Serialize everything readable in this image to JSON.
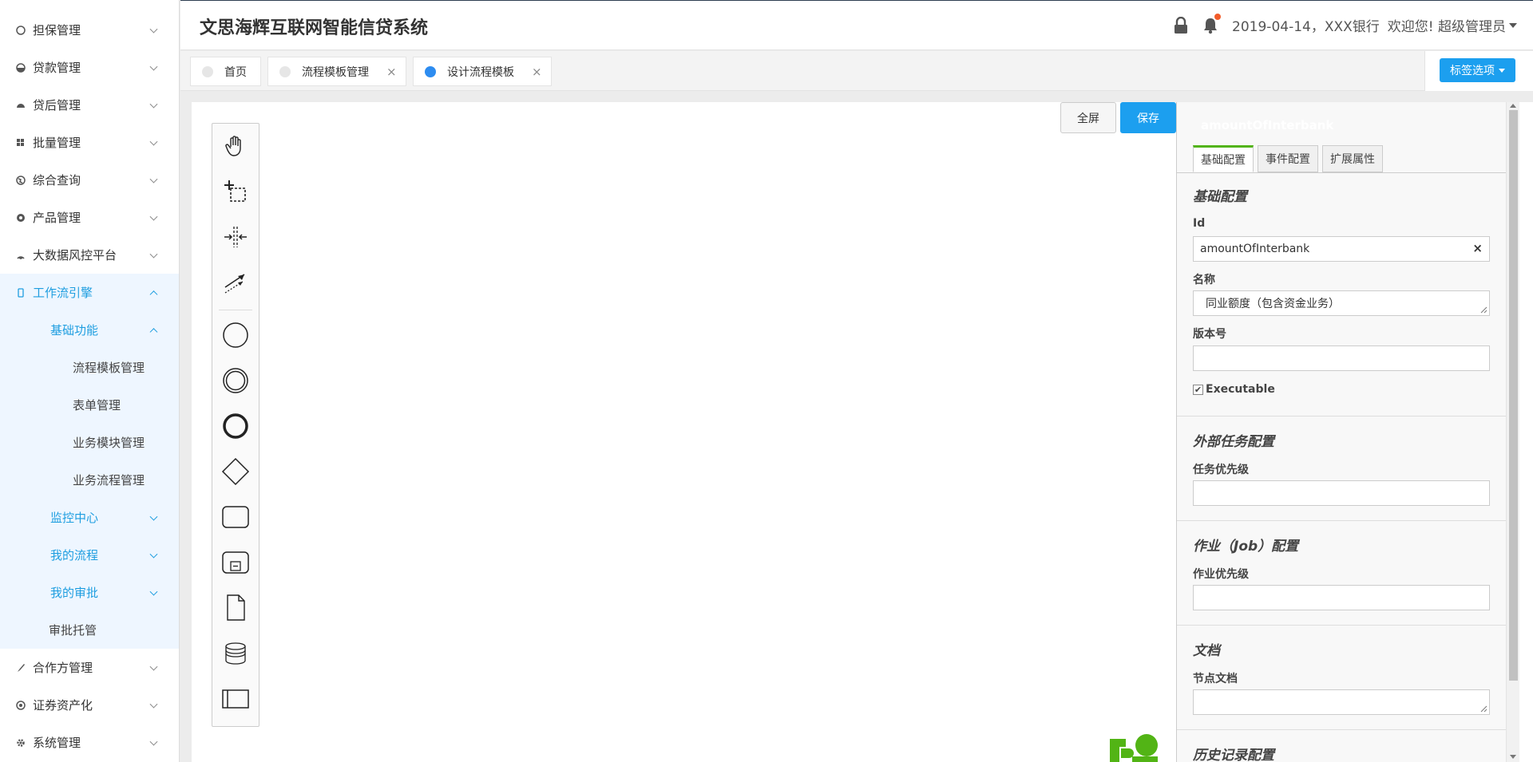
{
  "header": {
    "title": "文思海辉互联网智能信贷系统",
    "date_bank": "2019-04-14，XXX银行",
    "welcome": "欢迎您! 超级管理员"
  },
  "sidebar": {
    "items": [
      {
        "label": "担保管理",
        "icon": "circle-outline-icon"
      },
      {
        "label": "贷款管理",
        "icon": "pie-icon"
      },
      {
        "label": "贷后管理",
        "icon": "dome-icon"
      },
      {
        "label": "批量管理",
        "icon": "grid-icon"
      },
      {
        "label": "综合查询",
        "icon": "globe-icon"
      },
      {
        "label": "产品管理",
        "icon": "coin-icon"
      },
      {
        "label": "大数据风控平台",
        "icon": "signal-icon"
      },
      {
        "label": "工作流引擎",
        "icon": "mobile-icon"
      },
      {
        "label": "基础功能"
      },
      {
        "label": "流程模板管理"
      },
      {
        "label": "表单管理"
      },
      {
        "label": "业务模块管理"
      },
      {
        "label": "业务流程管理"
      },
      {
        "label": "监控中心"
      },
      {
        "label": "我的流程"
      },
      {
        "label": "我的审批"
      },
      {
        "label": "审批托管"
      },
      {
        "label": "合作方管理",
        "icon": "brush-icon"
      },
      {
        "label": "证券资产化",
        "icon": "target-icon"
      },
      {
        "label": "系统管理",
        "icon": "gear-icon"
      }
    ]
  },
  "tabs": [
    {
      "label": "首页"
    },
    {
      "label": "流程模板管理",
      "close": "×"
    },
    {
      "label": "设计流程模板",
      "close": "×"
    }
  ],
  "tag_options": "标签选项",
  "toolbar": {
    "fullscreen": "全屏",
    "save": "保存"
  },
  "palette": [
    "hand-tool-icon",
    "lasso-tool-icon",
    "space-tool-icon",
    "connect-tool-icon",
    "start-event-icon",
    "intermediate-event-icon",
    "end-event-icon",
    "gateway-icon",
    "task-icon",
    "subprocess-icon",
    "data-object-icon",
    "data-store-icon",
    "pool-icon"
  ],
  "props": {
    "element_name": "amountOfInterbank",
    "tabs": [
      "基础配置",
      "事件配置",
      "扩展属性"
    ],
    "basic_title": "基础配置",
    "id_label": "Id",
    "id_value": "amountOfInterbank",
    "clear": "×",
    "name_label": "名称",
    "name_value": "同业额度（包含资金业务）",
    "version_label": "版本号",
    "version_value": "",
    "executable_label": "Executable",
    "executable_mark": "✔",
    "external_title": "外部任务配置",
    "task_priority_label": "任务优先级",
    "job_title": "作业（Job）配置",
    "job_priority_label": "作业优先级",
    "doc_title": "文档",
    "doc_label": "节点文档",
    "history_title": "历史记录配置"
  },
  "colors": {
    "accent": "#1c9fef",
    "active_nav": "#1f9ee0",
    "tab_active": "#52b415",
    "logo": "#52b415"
  }
}
